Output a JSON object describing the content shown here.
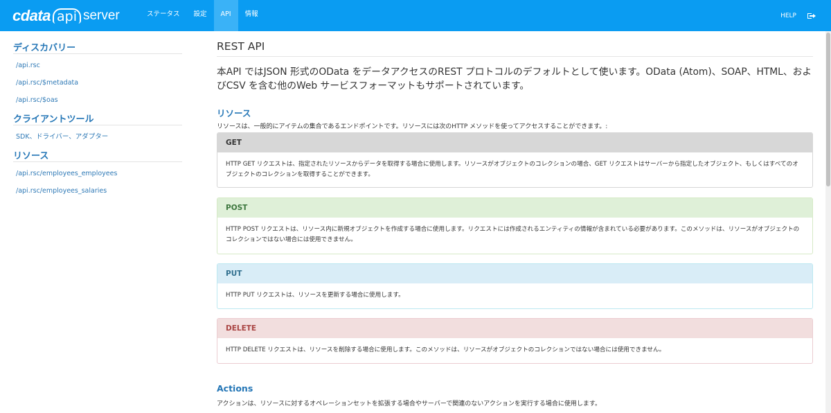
{
  "brand": {
    "logo": "cdata",
    "api": "api",
    "server": "server"
  },
  "nav": {
    "items": [
      {
        "label": "ステータス"
      },
      {
        "label": "設定"
      },
      {
        "label": "API",
        "active": true
      },
      {
        "label": "情報"
      }
    ],
    "help": "HELP",
    "logout_icon": "logout-icon"
  },
  "sidebar": {
    "discovery": {
      "heading": "ディスカバリー",
      "items": [
        "/api.rsc",
        "/api.rsc/$metadata",
        "/api.rsc/$oas"
      ]
    },
    "clients": {
      "heading": "クライアントツール",
      "items": [
        "SDK、ドライバー、アダプター"
      ]
    },
    "resources": {
      "heading": "リソース",
      "items": [
        "/api.rsc/employees_employees",
        "/api.rsc/employees_salaries"
      ]
    }
  },
  "main": {
    "title": "REST API",
    "lead": "本API ではJSON 形式のOData をデータアクセスのREST プロトコルのデフォルトとして使います。OData (Atom)、SOAP、HTML、およびCSV を含む他のWeb サービスフォーマットもサポートされています。",
    "resources_heading": "リソース",
    "resources_text": "リソースは、一般的にアイテムの集合であるエンドポイントです。リソースには次のHTTP メソッドを使ってアクセスすることができます。:",
    "methods": {
      "get": {
        "name": "GET",
        "desc": "HTTP GET リクエストは、指定されたリソースからデータを取得する場合に使用します。リソースがオブジェクトのコレクションの場合、GET リクエストはサーバーから指定したオブジェクト、もしくはすべてのオブジェクトのコレクションを取得することができます。"
      },
      "post": {
        "name": "POST",
        "desc": "HTTP POST リクエストは、リソース内に新規オブジェクトを作成する場合に使用します。リクエストには作成されるエンティティの情報が含まれている必要があります。このメソッドは、リソースがオブジェクトのコレクションではない場合には使用できません。"
      },
      "put": {
        "name": "PUT",
        "desc": "HTTP PUT リクエストは、リソースを更新する場合に使用します。"
      },
      "delete": {
        "name": "DELETE",
        "desc": "HTTP DELETE リクエストは、リソースを削除する場合に使用します。このメソッドは、リソースがオブジェクトのコレクションではない場合には使用できません。"
      }
    },
    "actions_heading": "Actions",
    "actions_text": "アクションは、リソースに対するオペレーションセットを拡張する場合やサーバーで関連のないアクションを実行する場合に使用します。"
  },
  "colors": {
    "navbar": "#0a9cf2",
    "nav_active": "#3ab2f7",
    "link": "#2476b6",
    "get_header": "#d7d7d7",
    "post_header": "#dff0d8",
    "put_header": "#d9edf7",
    "delete_header": "#f2dede"
  }
}
